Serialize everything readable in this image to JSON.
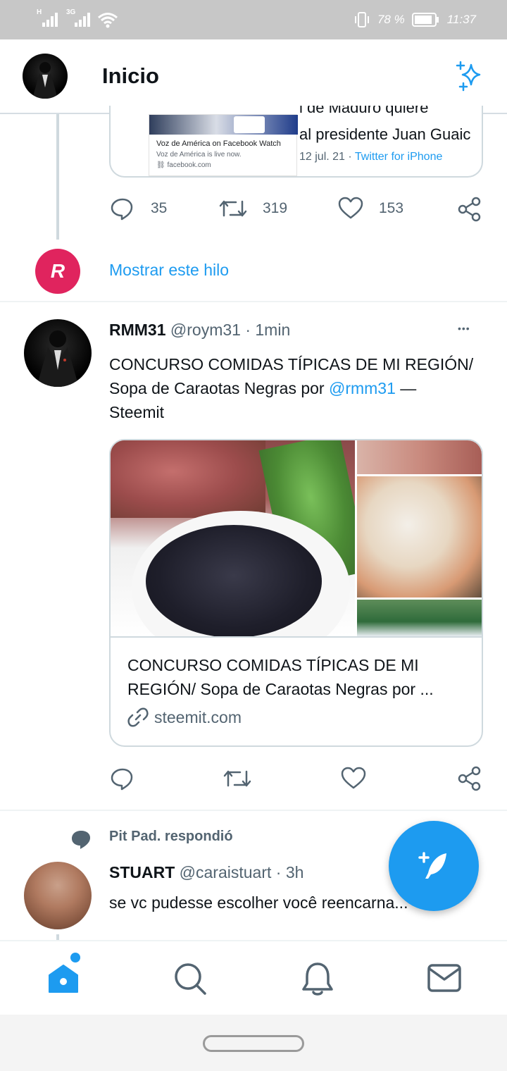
{
  "status_bar": {
    "network_1": "H",
    "network_2": "3G",
    "battery_percent": "78 %",
    "time": "11:37",
    "icons": [
      "signal-icon",
      "signal-icon",
      "wifi-icon",
      "vibrate-icon",
      "battery-icon"
    ]
  },
  "header": {
    "title": "Inicio",
    "icons": [
      "avatar",
      "sparkle-icon"
    ]
  },
  "previous_tweet": {
    "embed_caption_title": "Voz de América on Facebook Watch",
    "embed_caption_sub": "Voz de América is live now.",
    "embed_caption_domain": "facebook.com",
    "embed_text_line1": "l de Maduro quiere",
    "embed_text_line2": "al presidente Juan Guaic",
    "embed_meta_date": "12 jul. 21 · ",
    "embed_meta_source": "Twitter for iPhone",
    "reply_count": "35",
    "retweet_count": "319",
    "like_count": "153"
  },
  "show_thread": {
    "label": "Mostrar este hilo",
    "avatar_letter": "R",
    "avatar_color": "#e0245e"
  },
  "tweet": {
    "name": "RMM31",
    "handle": "@roym31",
    "time": "· 1min",
    "more": "•••",
    "text_line1": "CONCURSO COMIDAS TÍPICAS DE MI REGIÓN/",
    "text_line2_prefix": "Sopa de Caraotas Negras por ",
    "text_mention": "@rmm31",
    "text_line2_suffix": " —",
    "text_line3": "Steemit",
    "card_title_line1": "CONCURSO COMIDAS TÍPICAS DE MI",
    "card_title_line2": "REGIÓN/ Sopa de Caraotas Negras por ...",
    "card_domain": "steemit.com"
  },
  "reply_context": {
    "label": "Pit Pad. respondió"
  },
  "next_tweet": {
    "name": "STUART",
    "handle": "@caraistuart",
    "time": "· 3h",
    "text": "se vc pudesse escolher você reencarna..."
  },
  "bottom_nav": {
    "items": [
      "home-icon",
      "search-icon",
      "notifications-icon",
      "messages-icon"
    ]
  },
  "colors": {
    "accent": "#1d9bf0",
    "text": "#0f1419",
    "muted": "#536471",
    "border": "#cfd9de"
  }
}
